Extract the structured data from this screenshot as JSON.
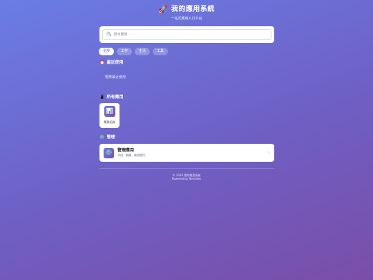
{
  "header": {
    "rocket_icon": "🚀",
    "title": "我的應用系統",
    "subtitle": "一站式應用入口平台"
  },
  "search": {
    "icon": "🔍",
    "placeholder": "搜尋應用...",
    "value": ""
  },
  "tabs": [
    {
      "label": "全部",
      "active": true
    },
    {
      "label": "工作",
      "active": false
    },
    {
      "label": "生活",
      "active": false
    },
    {
      "label": "工具",
      "active": false
    }
  ],
  "recent": {
    "icon": "⏰",
    "title": "最近使用",
    "empty_text": "暫無最近使用"
  },
  "all_apps": {
    "icon": "📱",
    "title": "所有應用",
    "items": [
      {
        "icon": "📊",
        "label": "應用記錄"
      }
    ]
  },
  "manage": {
    "icon": "⚙️",
    "title": "管理",
    "card": {
      "icon": "⚙️",
      "title": "管理應用",
      "description": "添加、編輯、刪除應用",
      "chevron": "›"
    }
  },
  "footer": {
    "copyright": "© 2026 我的應用系統",
    "powered_by": "Powered by Netclites"
  },
  "colors": {
    "gradient_start": "#6a7de6",
    "gradient_end": "#7a4ea8",
    "active_tab_text": "#6a66cc"
  }
}
